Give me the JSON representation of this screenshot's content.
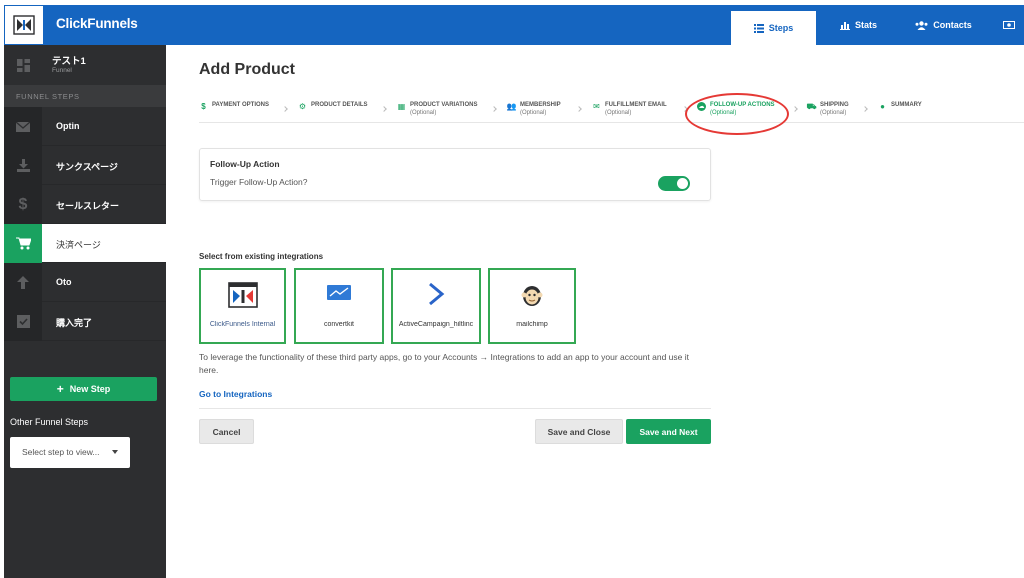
{
  "app": {
    "brand": "ClickFunnels"
  },
  "nav": {
    "steps": "Steps",
    "stats": "Stats",
    "contacts": "Contacts"
  },
  "funnel": {
    "name": "テスト1",
    "type": "Funnel"
  },
  "sidebar": {
    "heading": "FUNNEL STEPS",
    "items": [
      {
        "label": "Optin",
        "icon": "envelope-icon"
      },
      {
        "label": "サンクスページ",
        "icon": "download-icon"
      },
      {
        "label": "セールスレター",
        "icon": "dollar-icon"
      },
      {
        "label": "決済ページ",
        "icon": "cart-icon"
      },
      {
        "label": "Oto",
        "icon": "arrow-up-icon"
      },
      {
        "label": "購入完了",
        "icon": "checkbox-icon"
      }
    ],
    "active_index": 3,
    "new_step": "New Step",
    "other_steps": "Other Funnel Steps",
    "select_placeholder": "Select step to view..."
  },
  "page": {
    "title": "Add Product"
  },
  "wizard": [
    {
      "label": "PAYMENT OPTIONS",
      "optional": "",
      "icon": "dollar-icon"
    },
    {
      "label": "PRODUCT DETAILS",
      "optional": "",
      "icon": "gears-icon"
    },
    {
      "label": "PRODUCT VARIATIONS",
      "optional": "(Optional)",
      "icon": "cubes-icon"
    },
    {
      "label": "MEMBERSHIP",
      "optional": "(Optional)",
      "icon": "users-icon"
    },
    {
      "label": "FULFILLMENT EMAIL",
      "optional": "(Optional)",
      "icon": "envelope-icon"
    },
    {
      "label": "FOLLOW-UP ACTIONS",
      "optional": "(Optional)",
      "icon": "cloud-icon"
    },
    {
      "label": "SHIPPING",
      "optional": "(Optional)",
      "icon": "truck-icon"
    },
    {
      "label": "SUMMARY",
      "optional": "",
      "icon": "circle-check-icon"
    }
  ],
  "wizard_current": 5,
  "followup": {
    "title": "Follow-Up Action",
    "trigger_label": "Trigger Follow-Up Action?",
    "enabled": true
  },
  "integrations": {
    "heading": "Select from existing integrations",
    "items": [
      {
        "name": "ClickFunnels Internal"
      },
      {
        "name": "convertkit"
      },
      {
        "name": "ActiveCampaign_hiltlinc"
      },
      {
        "name": "mailchimp"
      }
    ],
    "info": "To leverage the functionality of these third party apps, go to your Accounts → Integrations to add an app to your account and use it here.",
    "link": "Go to Integrations"
  },
  "actions": {
    "cancel": "Cancel",
    "save_close": "Save and Close",
    "save_next": "Save and Next"
  },
  "colors": {
    "primary": "#1565c0",
    "success": "#1aa260",
    "sidebar": "#2d2e30",
    "highlight": "#34a853",
    "annotation": "#e53935"
  }
}
